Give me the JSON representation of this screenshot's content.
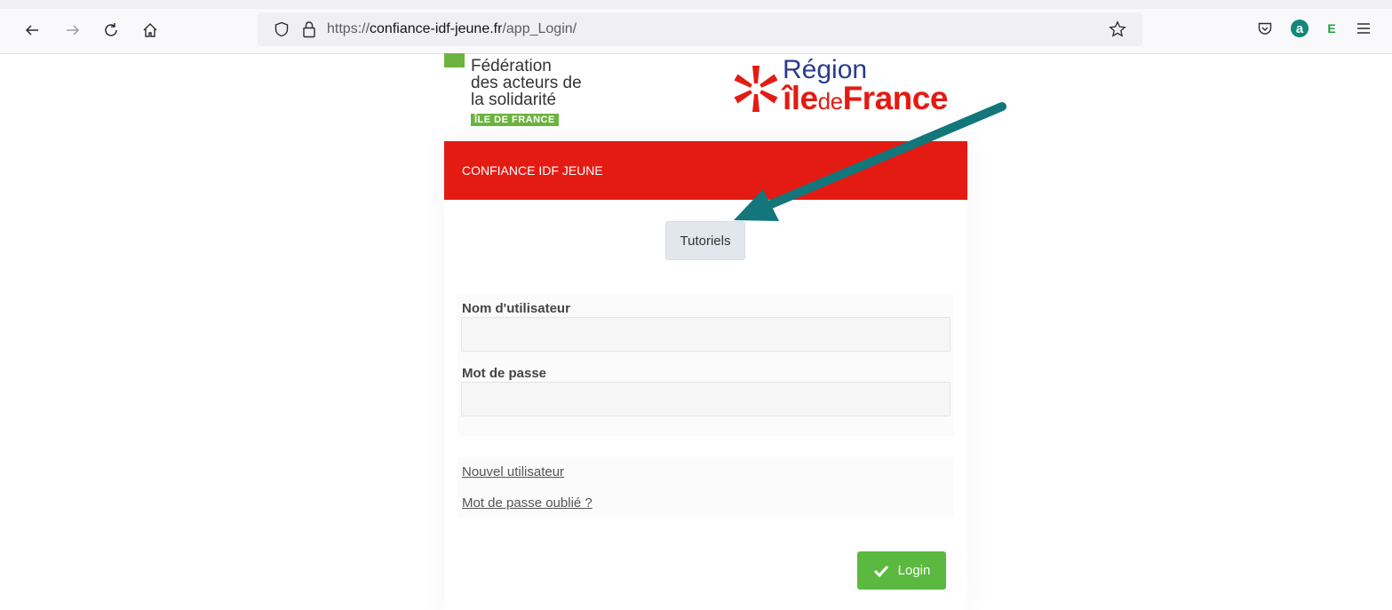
{
  "browser": {
    "url_scheme": "https://",
    "url_host": "confiance-idf-jeune.fr",
    "url_path": "/app_Login/",
    "extensions": {
      "a_label": "a",
      "e_label": "E"
    }
  },
  "logos": {
    "federation": {
      "lines": [
        "Fédération",
        "des acteurs de",
        "la solidarité"
      ],
      "badge": "ÎLE DE FRANCE"
    },
    "region": {
      "word": "Région",
      "name_part1": "île",
      "name_part2": "de",
      "name_part3": "France"
    }
  },
  "card": {
    "title": "CONFIANCE IDF JEUNE"
  },
  "tutoriels_button": "Tutoriels",
  "form": {
    "username_label": "Nom d'utilisateur",
    "username_value": "",
    "password_label": "Mot de passe",
    "password_value": ""
  },
  "links": {
    "new_user": "Nouvel utilisateur",
    "forgot_password": "Mot de passe oublié ?"
  },
  "login_button": "Login",
  "colors": {
    "header_red": "#e41b13",
    "login_green": "#5cb93f",
    "annotation_arrow": "#12767a"
  }
}
